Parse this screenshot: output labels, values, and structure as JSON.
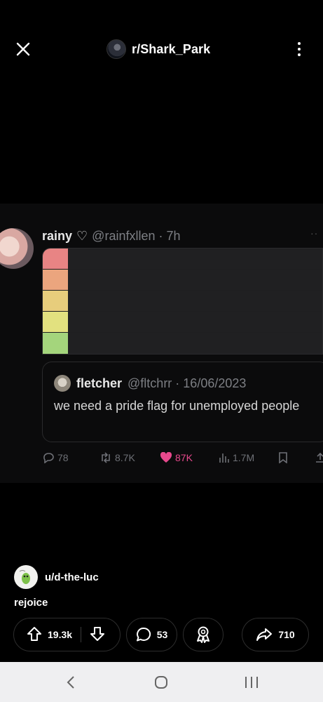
{
  "header": {
    "subreddit": "r/Shark_Park",
    "close_icon": "close-icon",
    "more_icon": "more-vertical-icon"
  },
  "tweet": {
    "name": "rainy",
    "handle_time": "@rainfxllen · 7h",
    "dots": "··",
    "flag_colors": [
      "#e88484",
      "#eba57e",
      "#e7cd7c",
      "#e2e17f",
      "#a4d57c"
    ],
    "quote": {
      "name": "fletcher",
      "handle_date": "@fltchrr · 16/06/2023",
      "text": "we need a pride flag for unemployed people"
    },
    "stats": {
      "replies": "78",
      "retweets": "8.7K",
      "likes": "87K",
      "views": "1.7M"
    },
    "like_color": "#e8498d"
  },
  "post": {
    "author": "u/d-the-luc",
    "title": "rejoice",
    "upvotes": "19.3k",
    "comments": "53",
    "shares": "710"
  }
}
